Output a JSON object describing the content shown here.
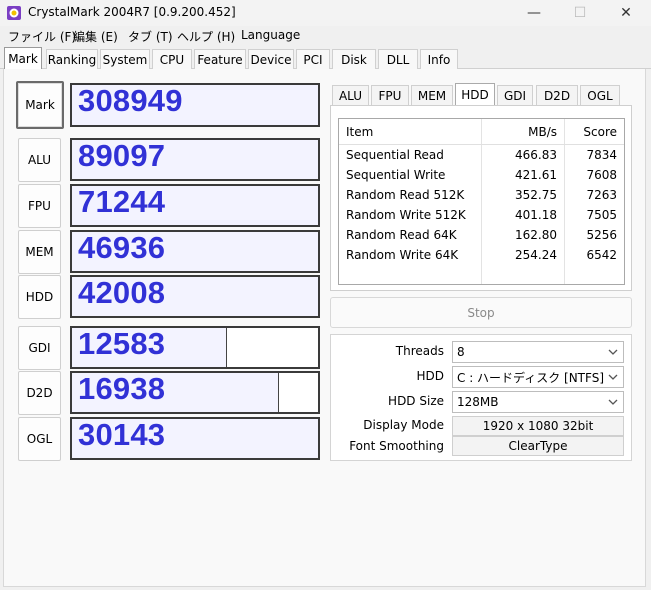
{
  "window": {
    "title": "CrystalMark 2004R7 [0.9.200.452]",
    "minimize_glyph": "—",
    "maximize_glyph": "☐",
    "close_glyph": "✕"
  },
  "menu": [
    "ファイル (F)",
    "編集 (E)",
    "タブ (T)",
    "ヘルプ (H)",
    "Language"
  ],
  "main_tabs": [
    "Mark",
    "Ranking",
    "System",
    "CPU",
    "Feature",
    "Device",
    "PCI",
    "Disk",
    "DLL",
    "Info"
  ],
  "active_main_tab": "Mark",
  "mark": {
    "label": "Mark",
    "score": "308949"
  },
  "scores": [
    {
      "label": "ALU",
      "score": "89097",
      "fill": 1.0
    },
    {
      "label": "FPU",
      "score": "71244",
      "fill": 1.0
    },
    {
      "label": "MEM",
      "score": "46936",
      "fill": 1.0
    },
    {
      "label": "HDD",
      "score": "42008",
      "fill": 1.0
    },
    {
      "label": "GDI",
      "score": "12583",
      "fill": 0.63
    },
    {
      "label": "D2D",
      "score": "16938",
      "fill": 0.84
    },
    {
      "label": "OGL",
      "score": "30143",
      "fill": 1.0
    }
  ],
  "sub_tabs": [
    "ALU",
    "FPU",
    "MEM",
    "HDD",
    "GDI",
    "D2D",
    "OGL"
  ],
  "active_sub_tab": "HDD",
  "table": {
    "headers": [
      "Item",
      "MB/s",
      "Score"
    ],
    "rows": [
      [
        "Sequential Read",
        "466.83",
        "7834"
      ],
      [
        "Sequential Write",
        "421.61",
        "7608"
      ],
      [
        "Random Read 512K",
        "352.75",
        "7263"
      ],
      [
        "Random Write 512K",
        "401.18",
        "7505"
      ],
      [
        "Random Read 64K",
        "162.80",
        "5256"
      ],
      [
        "Random Write 64K",
        "254.24",
        "6542"
      ]
    ]
  },
  "stop_label": "Stop",
  "settings": {
    "threads_label": "Threads",
    "threads_value": "8",
    "hdd_label": "HDD",
    "hdd_value": "C : ハードディスク [NTFS]",
    "hdd_size_label": "HDD Size",
    "hdd_size_value": "128MB",
    "display_mode_label": "Display Mode",
    "display_mode_value": "1920 x 1080 32bit",
    "font_smoothing_label": "Font Smoothing",
    "font_smoothing_value": "ClearType"
  },
  "colors": {
    "score_text": "#3131d6",
    "score_fill": "#f3f3ff",
    "app_icon_primary": "#7b3fc4",
    "app_icon_accent": "#f2c200"
  }
}
